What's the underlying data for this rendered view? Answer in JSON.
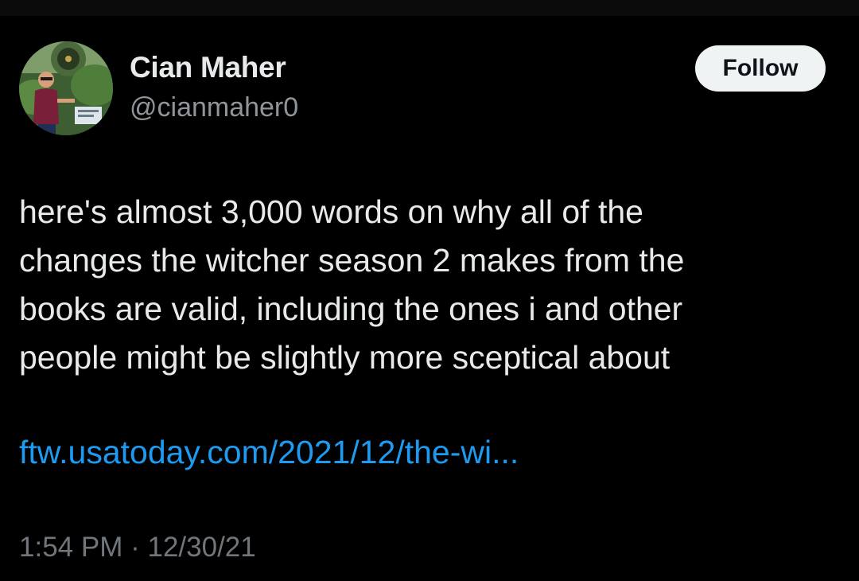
{
  "author": {
    "display_name": "Cian Maher",
    "handle": "@cianmaher0"
  },
  "actions": {
    "follow_label": "Follow"
  },
  "tweet": {
    "lines": [
      "here's almost 3,000 words on why all of the",
      "changes the witcher season 2 makes from the",
      "books are valid, including the ones i and other",
      "people might be slightly more sceptical about"
    ],
    "link": "ftw.usatoday.com/2021/12/the-wi...",
    "time": "1:54 PM",
    "separator": "·",
    "date": "12/30/21"
  },
  "colors": {
    "background": "#000000",
    "text": "#e7e9ea",
    "muted": "#71767b",
    "link": "#1d9bf0",
    "follow_bg": "#eff3f4"
  }
}
